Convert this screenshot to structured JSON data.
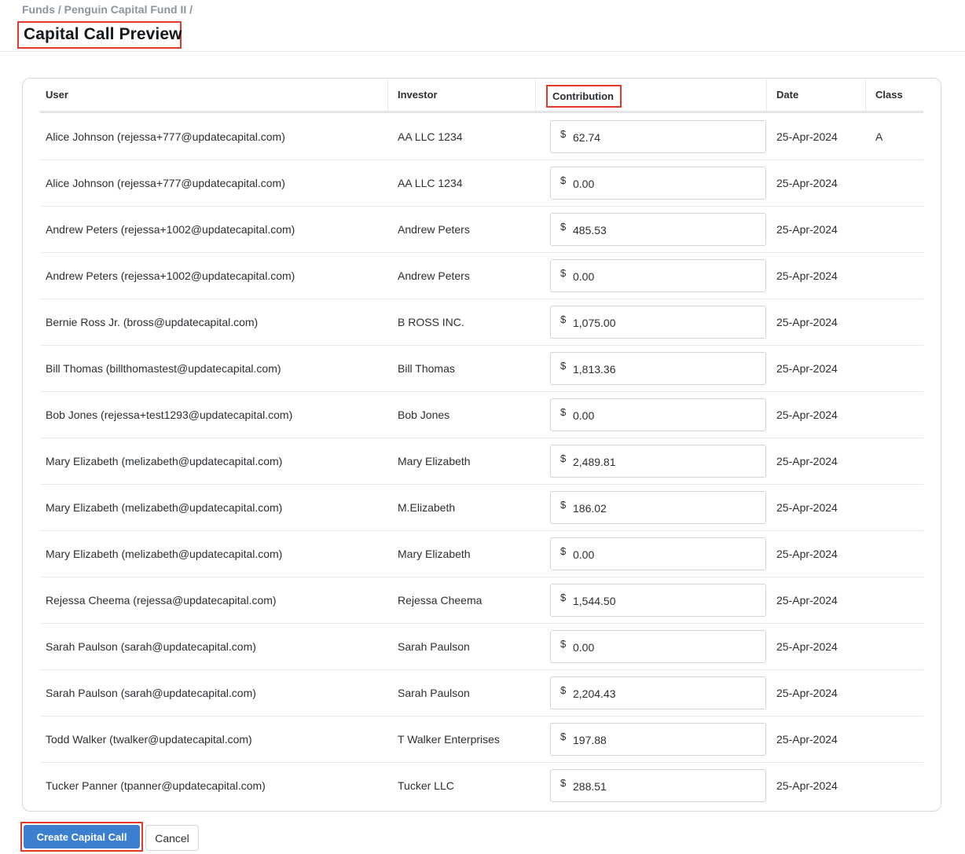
{
  "breadcrumb": {
    "funds": "Funds",
    "separator": " / ",
    "fund": "Penguin Capital Fund II",
    "trailing": " /"
  },
  "page_title": "Capital Call Preview",
  "table": {
    "columns": {
      "user": "User",
      "investor": "Investor",
      "contribution": "Contribution",
      "date": "Date",
      "class": "Class"
    },
    "currency_symbol": "$",
    "rows": [
      {
        "user": "Alice Johnson (rejessa+777@updatecapital.com)",
        "investor": "AA LLC 1234",
        "contribution": "62.74",
        "date": "25-Apr-2024",
        "class": "A"
      },
      {
        "user": "Alice Johnson (rejessa+777@updatecapital.com)",
        "investor": "AA LLC 1234",
        "contribution": "0.00",
        "date": "25-Apr-2024",
        "class": ""
      },
      {
        "user": "Andrew Peters (rejessa+1002@updatecapital.com)",
        "investor": "Andrew Peters",
        "contribution": "485.53",
        "date": "25-Apr-2024",
        "class": ""
      },
      {
        "user": "Andrew Peters (rejessa+1002@updatecapital.com)",
        "investor": "Andrew Peters",
        "contribution": "0.00",
        "date": "25-Apr-2024",
        "class": ""
      },
      {
        "user": "Bernie Ross Jr. (bross@updatecapital.com)",
        "investor": "B ROSS INC.",
        "contribution": "1,075.00",
        "date": "25-Apr-2024",
        "class": ""
      },
      {
        "user": "Bill Thomas (billthomastest@updatecapital.com)",
        "investor": "Bill Thomas",
        "contribution": "1,813.36",
        "date": "25-Apr-2024",
        "class": ""
      },
      {
        "user": "Bob Jones (rejessa+test1293@updatecapital.com)",
        "investor": "Bob Jones",
        "contribution": "0.00",
        "date": "25-Apr-2024",
        "class": ""
      },
      {
        "user": "Mary Elizabeth (melizabeth@updatecapital.com)",
        "investor": "Mary Elizabeth",
        "contribution": "2,489.81",
        "date": "25-Apr-2024",
        "class": ""
      },
      {
        "user": "Mary Elizabeth (melizabeth@updatecapital.com)",
        "investor": "M.Elizabeth",
        "contribution": "186.02",
        "date": "25-Apr-2024",
        "class": ""
      },
      {
        "user": "Mary Elizabeth (melizabeth@updatecapital.com)",
        "investor": "Mary Elizabeth",
        "contribution": "0.00",
        "date": "25-Apr-2024",
        "class": ""
      },
      {
        "user": "Rejessa Cheema (rejessa@updatecapital.com)",
        "investor": "Rejessa Cheema",
        "contribution": "1,544.50",
        "date": "25-Apr-2024",
        "class": ""
      },
      {
        "user": "Sarah Paulson (sarah@updatecapital.com)",
        "investor": "Sarah Paulson",
        "contribution": "0.00",
        "date": "25-Apr-2024",
        "class": ""
      },
      {
        "user": "Sarah Paulson (sarah@updatecapital.com)",
        "investor": "Sarah Paulson",
        "contribution": "2,204.43",
        "date": "25-Apr-2024",
        "class": ""
      },
      {
        "user": "Todd Walker (twalker@updatecapital.com)",
        "investor": "T Walker Enterprises",
        "contribution": "197.88",
        "date": "25-Apr-2024",
        "class": ""
      },
      {
        "user": "Tucker Panner (tpanner@updatecapital.com)",
        "investor": "Tucker LLC",
        "contribution": "288.51",
        "date": "25-Apr-2024",
        "class": ""
      }
    ]
  },
  "actions": {
    "create_label": "Create Capital Call",
    "cancel_label": "Cancel"
  },
  "colors": {
    "primary_button": "#3a7fd0",
    "highlight_border": "#e23a2a",
    "breadcrumb_text": "#8c949d"
  }
}
